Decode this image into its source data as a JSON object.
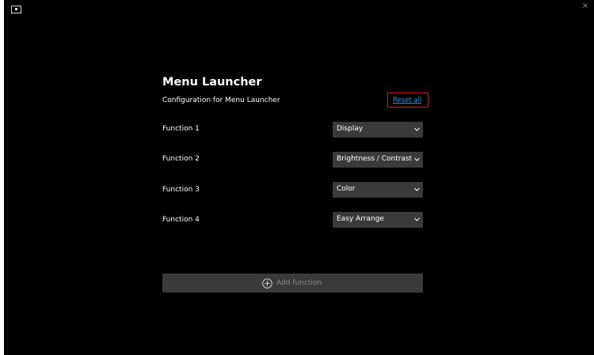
{
  "window": {
    "close_glyph": "×"
  },
  "header": {
    "title": "Menu Launcher",
    "subtitle": "Configuration for Menu Launcher",
    "reset_label": "Reset all"
  },
  "functions": [
    {
      "label": "Function 1",
      "value": "Display"
    },
    {
      "label": "Function 2",
      "value": "Brightness / Contrast"
    },
    {
      "label": "Function 3",
      "value": "Color"
    },
    {
      "label": "Function 4",
      "value": "Easy Arrange"
    }
  ],
  "add_function": {
    "label": "Add function",
    "icon": "plus-circle-icon"
  },
  "colors": {
    "background": "#000000",
    "control": "#3a3a3a",
    "link": "#3d8ee6",
    "highlight": "#e01b1b"
  }
}
